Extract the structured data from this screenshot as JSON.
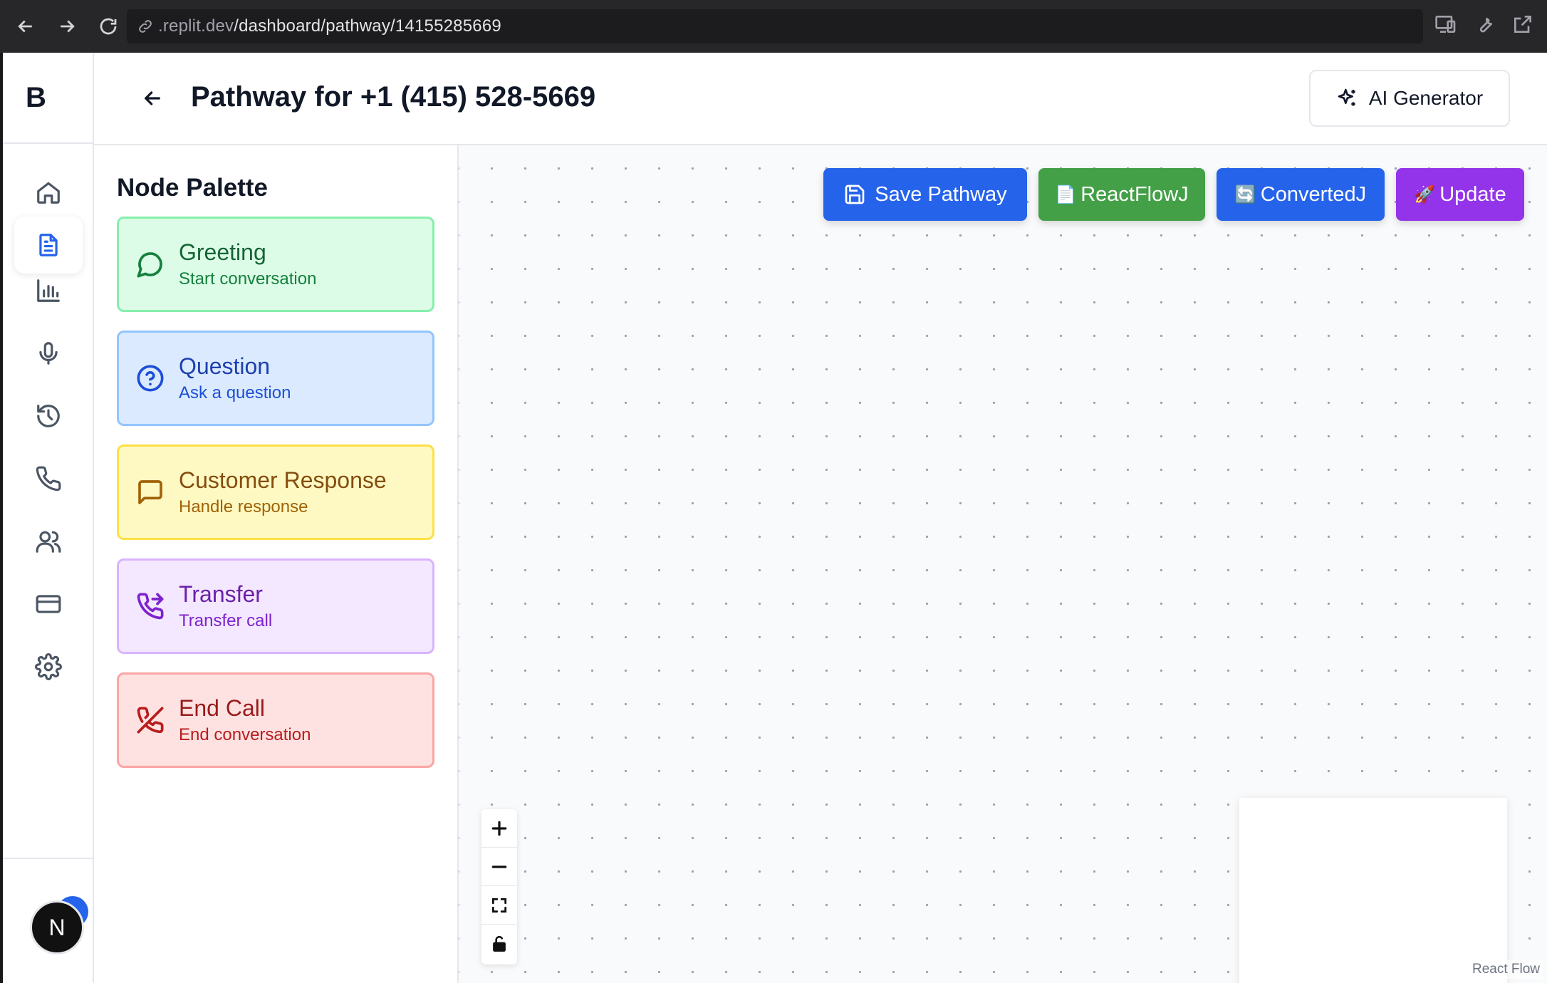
{
  "browser": {
    "url_prefix": ".replit.dev",
    "url_path": "/dashboard/pathway/14155285669"
  },
  "rail": {
    "logo": "B",
    "items": [
      {
        "icon": "home-icon",
        "active": false
      },
      {
        "icon": "document-icon",
        "active": true
      },
      {
        "icon": "bar-chart-icon",
        "active": false
      },
      {
        "icon": "microphone-icon",
        "active": false
      },
      {
        "icon": "history-icon",
        "active": false
      },
      {
        "icon": "phone-icon",
        "active": false
      },
      {
        "icon": "users-icon",
        "active": false
      },
      {
        "icon": "credit-card-icon",
        "active": false
      },
      {
        "icon": "gear-icon",
        "active": false
      }
    ],
    "avatar_letter": "N"
  },
  "header": {
    "title": "Pathway for +1 (415) 528-5669",
    "ai_button": "AI Generator"
  },
  "palette": {
    "title": "Node Palette",
    "nodes": [
      {
        "title": "Greeting",
        "subtitle": "Start conversation",
        "color": "#dcfce7"
      },
      {
        "title": "Question",
        "subtitle": "Ask a question",
        "color": "#dbeafe"
      },
      {
        "title": "Customer Response",
        "subtitle": "Handle response",
        "color": "#fef9c3"
      },
      {
        "title": "Transfer",
        "subtitle": "Transfer call",
        "color": "#f3e8ff"
      },
      {
        "title": "End Call",
        "subtitle": "End conversation",
        "color": "#fee2e2"
      }
    ]
  },
  "toolbar": {
    "save": "Save Pathway",
    "reactflow": "ReactFlowJ",
    "converted": "ConvertedJ",
    "update": "Update",
    "reactflow_emoji": "📄",
    "converted_emoji": "🔄",
    "update_emoji": "🚀"
  },
  "canvas": {
    "attribution": "React Flow"
  }
}
